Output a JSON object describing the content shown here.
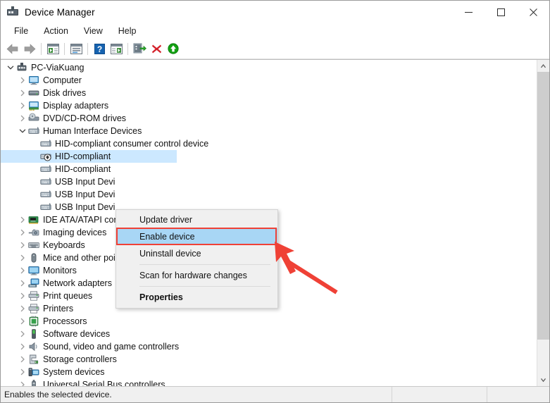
{
  "window": {
    "title": "Device Manager",
    "title_icon": "device-manager-icon",
    "minimize_label": "─",
    "maximize_label": "□",
    "close_label": "✕"
  },
  "menubar": {
    "items": [
      {
        "label": "File"
      },
      {
        "label": "Action"
      },
      {
        "label": "View"
      },
      {
        "label": "Help"
      }
    ]
  },
  "toolbar": {
    "buttons": [
      {
        "name": "back-icon",
        "tooltip": "Back"
      },
      {
        "name": "forward-icon",
        "tooltip": "Forward"
      },
      {
        "name": "show-hide-console-tree-icon",
        "tooltip": "Show/Hide Console Tree"
      },
      {
        "name": "properties-icon",
        "tooltip": "Properties"
      },
      {
        "name": "help-icon",
        "tooltip": "Help"
      },
      {
        "name": "show-hide-action-pane-icon",
        "tooltip": "Show/Hide Action Pane"
      },
      {
        "name": "update-driver-icon",
        "tooltip": "Update Driver Software"
      },
      {
        "name": "scan-for-hardware-changes-icon",
        "tooltip": "Scan for hardware changes"
      },
      {
        "name": "uninstall-device-icon",
        "tooltip": "Uninstall device"
      },
      {
        "name": "enable-device-icon",
        "tooltip": "Enable device"
      }
    ]
  },
  "tree": {
    "root": {
      "label": "PC-ViaKuang",
      "icon": "computer-root-icon",
      "expanded": true
    },
    "items": [
      {
        "label": "Computer",
        "icon": "computer-icon",
        "indent": 1,
        "expandable": true,
        "expanded": false
      },
      {
        "label": "Disk drives",
        "icon": "disk-drive-icon",
        "indent": 1,
        "expandable": true,
        "expanded": false
      },
      {
        "label": "Display adapters",
        "icon": "display-adapter-icon",
        "indent": 1,
        "expandable": true,
        "expanded": false
      },
      {
        "label": "DVD/CD-ROM drives",
        "icon": "dvd-drive-icon",
        "indent": 1,
        "expandable": true,
        "expanded": false
      },
      {
        "label": "Human Interface Devices",
        "icon": "hid-icon",
        "indent": 1,
        "expandable": true,
        "expanded": true
      },
      {
        "label": "HID-compliant consumer control device",
        "icon": "hid-icon",
        "indent": 2,
        "expandable": false,
        "expanded": false
      },
      {
        "label": "HID-compliant",
        "icon": "hid-disabled-icon",
        "indent": 2,
        "expandable": false,
        "expanded": false,
        "selected": true
      },
      {
        "label": "HID-compliant",
        "icon": "hid-icon",
        "indent": 2,
        "expandable": false,
        "expanded": false
      },
      {
        "label": "USB Input Devi",
        "icon": "hid-icon",
        "indent": 2,
        "expandable": false,
        "expanded": false
      },
      {
        "label": "USB Input Devi",
        "icon": "hid-icon",
        "indent": 2,
        "expandable": false,
        "expanded": false
      },
      {
        "label": "USB Input Devi",
        "icon": "hid-icon",
        "indent": 2,
        "expandable": false,
        "expanded": false
      },
      {
        "label": "IDE ATA/ATAPI con",
        "icon": "ide-controller-icon",
        "indent": 1,
        "expandable": true,
        "expanded": false
      },
      {
        "label": "Imaging devices",
        "icon": "imaging-device-icon",
        "indent": 1,
        "expandable": true,
        "expanded": false
      },
      {
        "label": "Keyboards",
        "icon": "keyboard-icon",
        "indent": 1,
        "expandable": true,
        "expanded": false
      },
      {
        "label": "Mice and other pointing devices",
        "icon": "mouse-icon",
        "indent": 1,
        "expandable": true,
        "expanded": false
      },
      {
        "label": "Monitors",
        "icon": "monitor-icon",
        "indent": 1,
        "expandable": true,
        "expanded": false
      },
      {
        "label": "Network adapters",
        "icon": "network-adapter-icon",
        "indent": 1,
        "expandable": true,
        "expanded": false
      },
      {
        "label": "Print queues",
        "icon": "printer-icon",
        "indent": 1,
        "expandable": true,
        "expanded": false
      },
      {
        "label": "Printers",
        "icon": "printer-icon",
        "indent": 1,
        "expandable": true,
        "expanded": false
      },
      {
        "label": "Processors",
        "icon": "processor-icon",
        "indent": 1,
        "expandable": true,
        "expanded": false
      },
      {
        "label": "Software devices",
        "icon": "software-device-icon",
        "indent": 1,
        "expandable": true,
        "expanded": false
      },
      {
        "label": "Sound, video and game controllers",
        "icon": "sound-device-icon",
        "indent": 1,
        "expandable": true,
        "expanded": false
      },
      {
        "label": "Storage controllers",
        "icon": "storage-controller-icon",
        "indent": 1,
        "expandable": true,
        "expanded": false
      },
      {
        "label": "System devices",
        "icon": "system-device-icon",
        "indent": 1,
        "expandable": true,
        "expanded": false
      },
      {
        "label": "Universal Serial Bus controllers",
        "icon": "usb-controller-icon",
        "indent": 1,
        "expandable": true,
        "expanded": false
      }
    ]
  },
  "context_menu": {
    "items": [
      {
        "label": "Update driver",
        "highlighted": false,
        "bold": false
      },
      {
        "label": "Enable device",
        "highlighted": true,
        "bold": false
      },
      {
        "label": "Uninstall device",
        "highlighted": false,
        "bold": false
      },
      {
        "separator": true
      },
      {
        "label": "Scan for hardware changes",
        "highlighted": false,
        "bold": false
      },
      {
        "separator": true
      },
      {
        "label": "Properties",
        "highlighted": false,
        "bold": true
      }
    ]
  },
  "annotation": {
    "highlight_color": "#ef4136",
    "arrow_color": "#ef4136",
    "target": "Enable device"
  },
  "statusbar": {
    "message": "Enables the selected device.",
    "pane2": "",
    "pane3": ""
  },
  "colors": {
    "selection": "#cce8ff",
    "menu_highlight": "#a8d6f5",
    "accent_red": "#ef4136",
    "accent_green": "#1aa01a"
  }
}
